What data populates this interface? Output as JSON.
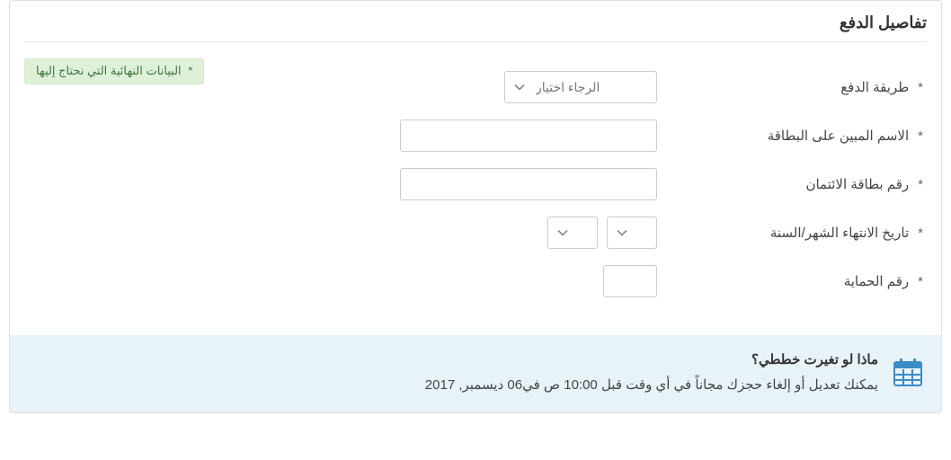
{
  "panel": {
    "title": "تفاصيل الدفع",
    "required_badge": "البيانات النهائية التي نحتاج إليها"
  },
  "form": {
    "asterisk": "*",
    "payment_method": {
      "label": "طريقة الدفع",
      "placeholder": "الرجاء اختيار"
    },
    "name_on_card": {
      "label": "الاسم المبين على البطاقة",
      "value": ""
    },
    "card_number": {
      "label": "رقم بطاقة الائتمان",
      "value": ""
    },
    "expiry": {
      "label": "تاريخ الانتهاء الشهر/السنة"
    },
    "cvv": {
      "label": "رقم الحماية",
      "value": ""
    }
  },
  "info": {
    "title": "ماذا لو تغيرت خططي؟",
    "desc": "يمكنك تعديل أو إلغاء حجزك مجاناً في أي وقت قبل 10:00 ص في06 ديسمبر, 2017"
  }
}
